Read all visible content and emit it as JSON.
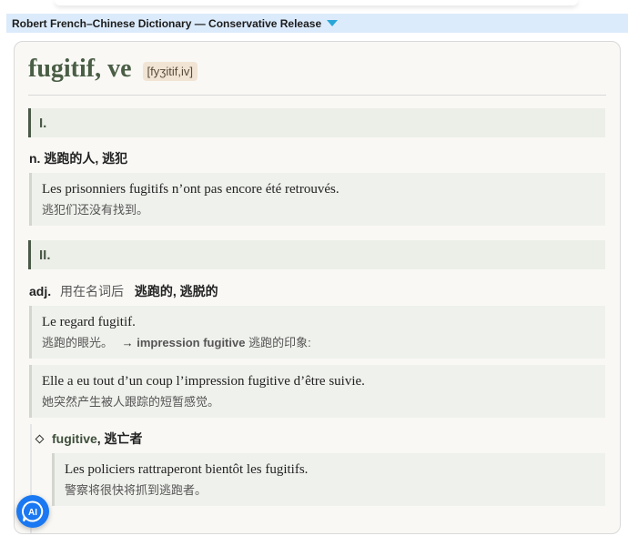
{
  "window": {
    "title": "Robert French–Chinese Dictionary — Conservative Release",
    "dropdown_icon": "triangle-down-icon"
  },
  "entry": {
    "headword": "fugitif, ve",
    "pronunciation": "[fyʒitif,iv]",
    "senses": [
      {
        "number": "I.",
        "pos": "n.",
        "translation": "逃跑的人, 逃犯",
        "examples": [
          {
            "fr": "Les prisonniers fugitifs n’ont pas encore été retrouvés.",
            "zh": "逃犯们还没有找到。"
          }
        ]
      },
      {
        "number": "II.",
        "pos": "adj.",
        "usage": "用在名词后",
        "translation": "逃跑的, 逃脱的",
        "examples": [
          {
            "fr": "Le regard fugitif.",
            "zh": "逃跑的眼光。",
            "arrow": "→",
            "collocation": "impression fugitive",
            "collocation_zh": "逃跑的印象:"
          },
          {
            "fr": "Elle a eu tout d’un coup l’impression fugitive d’être suivie.",
            "zh": "她突然产生被人跟踪的短暂感觉。"
          }
        ],
        "subentry": {
          "word": "fugitive",
          "translation": ", 逃亡者",
          "examples": [
            {
              "fr": "Les policiers rattraperont bientôt les fugitifs.",
              "zh": "警察将很快将抓到逃跑者。"
            }
          ]
        }
      }
    ]
  },
  "ai_button": {
    "label": "AI",
    "icon": "ai-chat-icon",
    "color": "#1a78f2"
  },
  "colors": {
    "headword": "#4a5e45",
    "titlebar": "#dcebfb",
    "sense_bar": "#4b5a47",
    "pron_bg": "#f1e4d4"
  }
}
